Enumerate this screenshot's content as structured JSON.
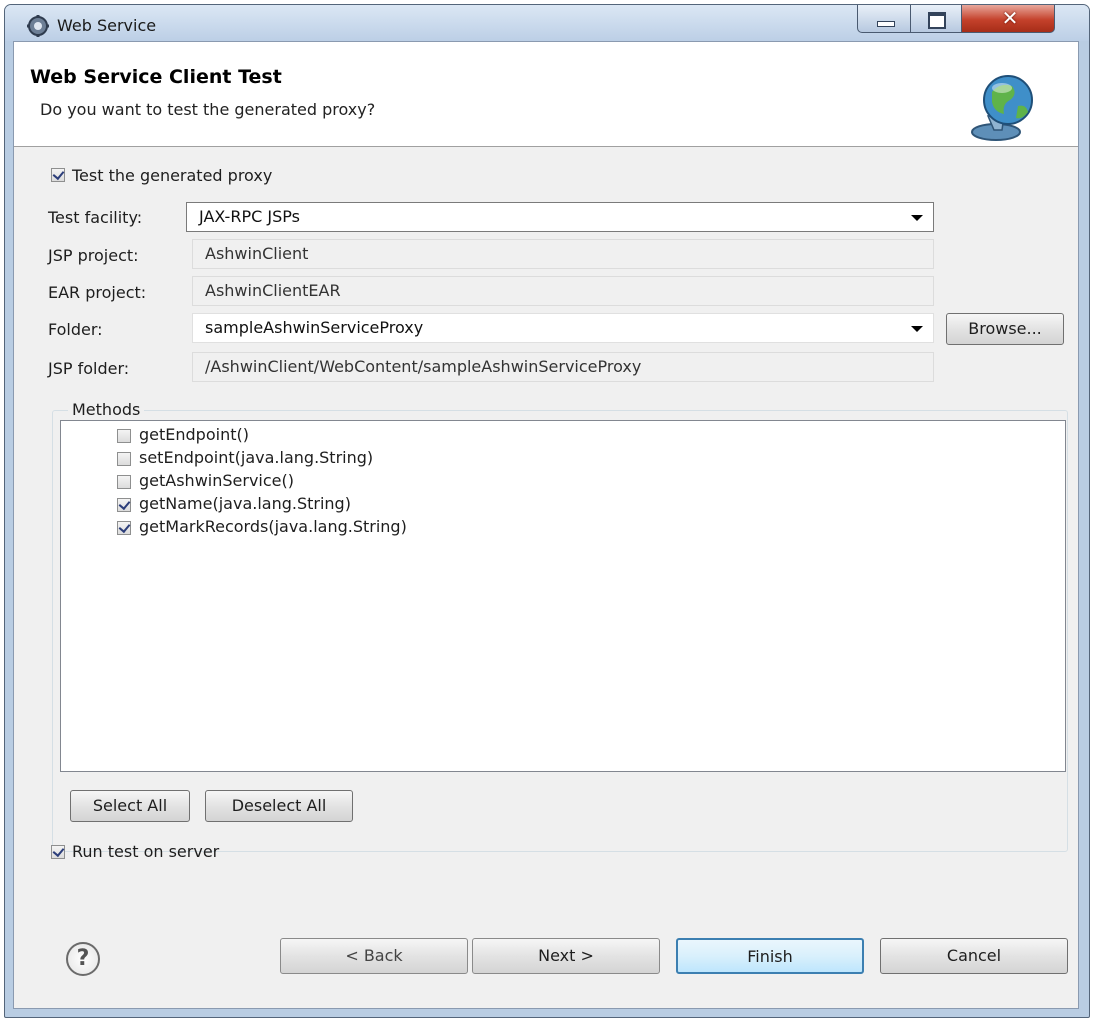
{
  "window": {
    "title": "Web Service"
  },
  "banner": {
    "title": "Web Service Client Test",
    "description": "Do you want to test the generated proxy?"
  },
  "test_proxy": {
    "label": "Test the generated proxy",
    "checked": true
  },
  "form": {
    "test_facility": {
      "label": "Test facility:",
      "value": "JAX-RPC JSPs"
    },
    "jsp_project": {
      "label": "JSP project:",
      "value": "AshwinClient"
    },
    "ear_project": {
      "label": "EAR project:",
      "value": "AshwinClientEAR"
    },
    "folder": {
      "label": "Folder:",
      "value": "sampleAshwinServiceProxy",
      "browse_label": "Browse..."
    },
    "jsp_folder": {
      "label": "JSP folder:",
      "value": "/AshwinClient/WebContent/sampleAshwinServiceProxy"
    }
  },
  "methods": {
    "legend": "Methods",
    "items": [
      {
        "label": "getEndpoint()",
        "checked": false
      },
      {
        "label": "setEndpoint(java.lang.String)",
        "checked": false
      },
      {
        "label": "getAshwinService()",
        "checked": false
      },
      {
        "label": "getName(java.lang.String)",
        "checked": true
      },
      {
        "label": "getMarkRecords(java.lang.String)",
        "checked": true
      }
    ],
    "select_all_label": "Select All",
    "deselect_all_label": "Deselect All"
  },
  "run_test": {
    "label": "Run test on server",
    "checked": true
  },
  "footer": {
    "help_glyph": "?",
    "back_label": "< Back",
    "next_label": "Next >",
    "finish_label": "Finish",
    "cancel_label": "Cancel"
  }
}
